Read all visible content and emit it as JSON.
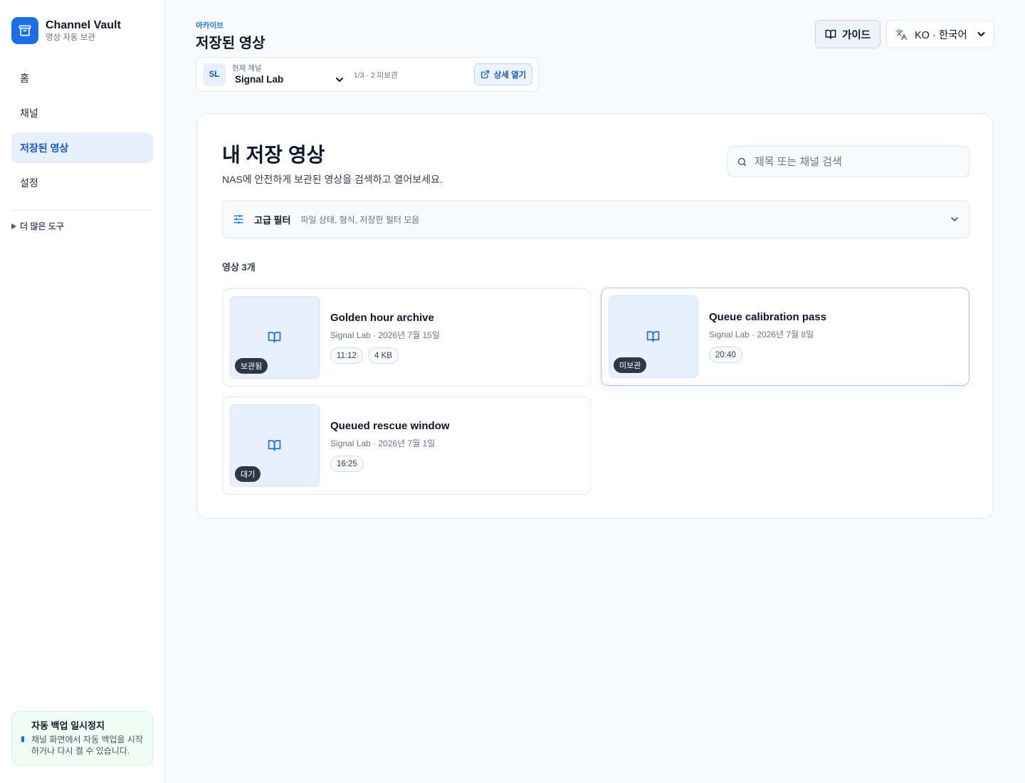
{
  "app": {
    "name": "Channel Vault",
    "subtitle": "영상 자동 보관",
    "accent_color": "#1d6fe8"
  },
  "sidebar": {
    "items": [
      {
        "label": "홈",
        "active": false
      },
      {
        "label": "채널",
        "active": false
      },
      {
        "label": "저장된 영상",
        "active": true
      },
      {
        "label": "설정",
        "active": false
      }
    ],
    "more_tools": "더 많은 도구",
    "backup": {
      "title": "자동 백업 일시정지",
      "text": "채널 화면에서 자동 백업을 시작하거나 다시 켤 수 있습니다."
    }
  },
  "header": {
    "eyebrow": "아카이브",
    "title": "저장된 영상",
    "channel": {
      "avatar": "SL",
      "label": "현재 채널",
      "selected": "Signal Lab",
      "count": "1/3 · 2 미보관",
      "detail_button": "상세 열기"
    },
    "guide_button": "가이드",
    "language": "KO · 한국어"
  },
  "main": {
    "title": "내 저장 영상",
    "subtitle": "NAS에 안전하게 보관된 영상을 검색하고 열어보세요.",
    "search_placeholder": "제목 또는 채널 검색",
    "filter": {
      "title": "고급 필터",
      "description": "파일 상태, 형식, 저장한 필터 모음"
    },
    "count_label": "영상 3개",
    "videos": [
      {
        "title": "Golden hour archive",
        "meta": "Signal Lab · 2026년 7월 15일",
        "badge": "보관됨",
        "chips": [
          "11:12",
          "4 KB"
        ]
      },
      {
        "title": "Queue calibration pass",
        "meta": "Signal Lab · 2026년 7월 8일",
        "badge": "미보관",
        "chips": [
          "20:40"
        ]
      },
      {
        "title": "Queued rescue window",
        "meta": "Signal Lab · 2026년 7월 1일",
        "badge": "대기",
        "chips": [
          "16:25"
        ]
      }
    ]
  }
}
